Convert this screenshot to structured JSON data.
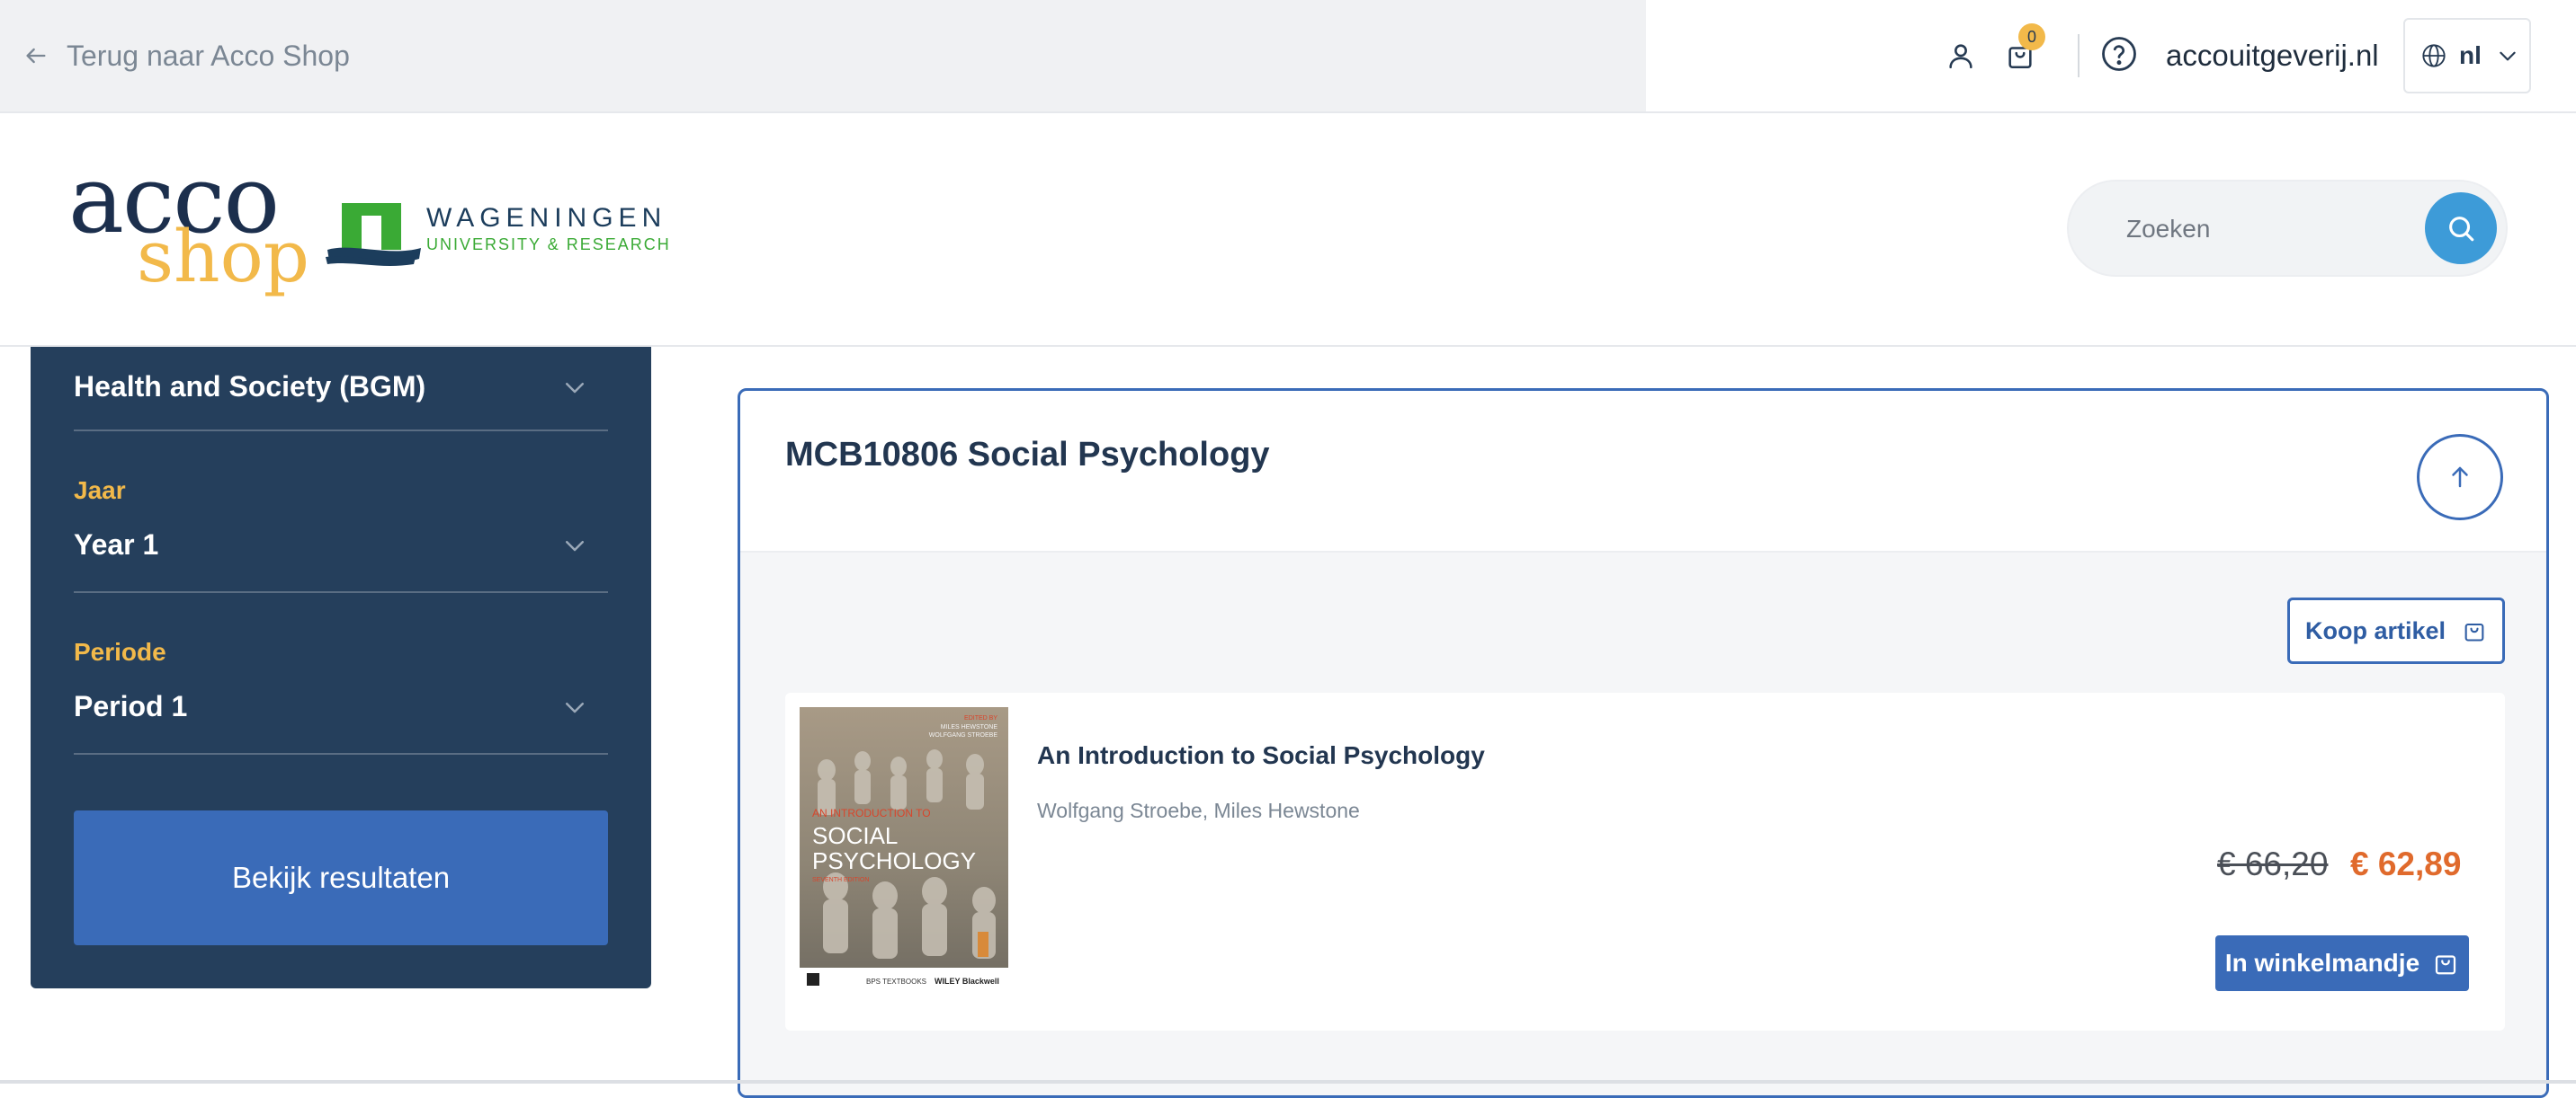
{
  "topbar": {
    "back_label": "Terug naar Acco Shop",
    "cart_count": "0",
    "site_link": "accouitgeverij.nl",
    "language": "nl"
  },
  "header": {
    "logo_acco_top": "acco",
    "logo_acco_bottom": "shop",
    "logo_wur_top": "WAGENINGEN",
    "logo_wur_bottom": "UNIVERSITY & RESEARCH",
    "search_placeholder": "Zoeken"
  },
  "sidebar": {
    "filters": [
      {
        "label": "",
        "value": "Health and Society (BGM)"
      },
      {
        "label": "Jaar",
        "value": "Year 1"
      },
      {
        "label": "Periode",
        "value": "Period 1"
      }
    ],
    "results_button": "Bekijk resultaten"
  },
  "course": {
    "title": "MCB10806 Social Psychology",
    "buy_button": "Koop artikel",
    "product": {
      "title": "An Introduction to Social Psychology",
      "authors": "Wolfgang Stroebe, Miles Hewstone",
      "old_price": "€ 66,20",
      "new_price": "€ 62,89",
      "add_to_cart": "In winkelmandje",
      "cover": {
        "editors_top": "EDITED BY",
        "editors": "MILES HEWSTONE\nWOLFGANG STROEBE",
        "title_small": "AN INTRODUCTION TO",
        "title_big1": "SOCIAL",
        "title_big2": "PSYCHOLOGY",
        "edition": "SEVENTH EDITION",
        "footer_left": "BPS TEXTBOOKS",
        "footer_right": "WILEY Blackwell"
      }
    }
  },
  "colors": {
    "accent_blue": "#3a6bb8",
    "navy": "#253f5c",
    "gold": "#f2b94a",
    "price_orange": "#e06a2c"
  }
}
